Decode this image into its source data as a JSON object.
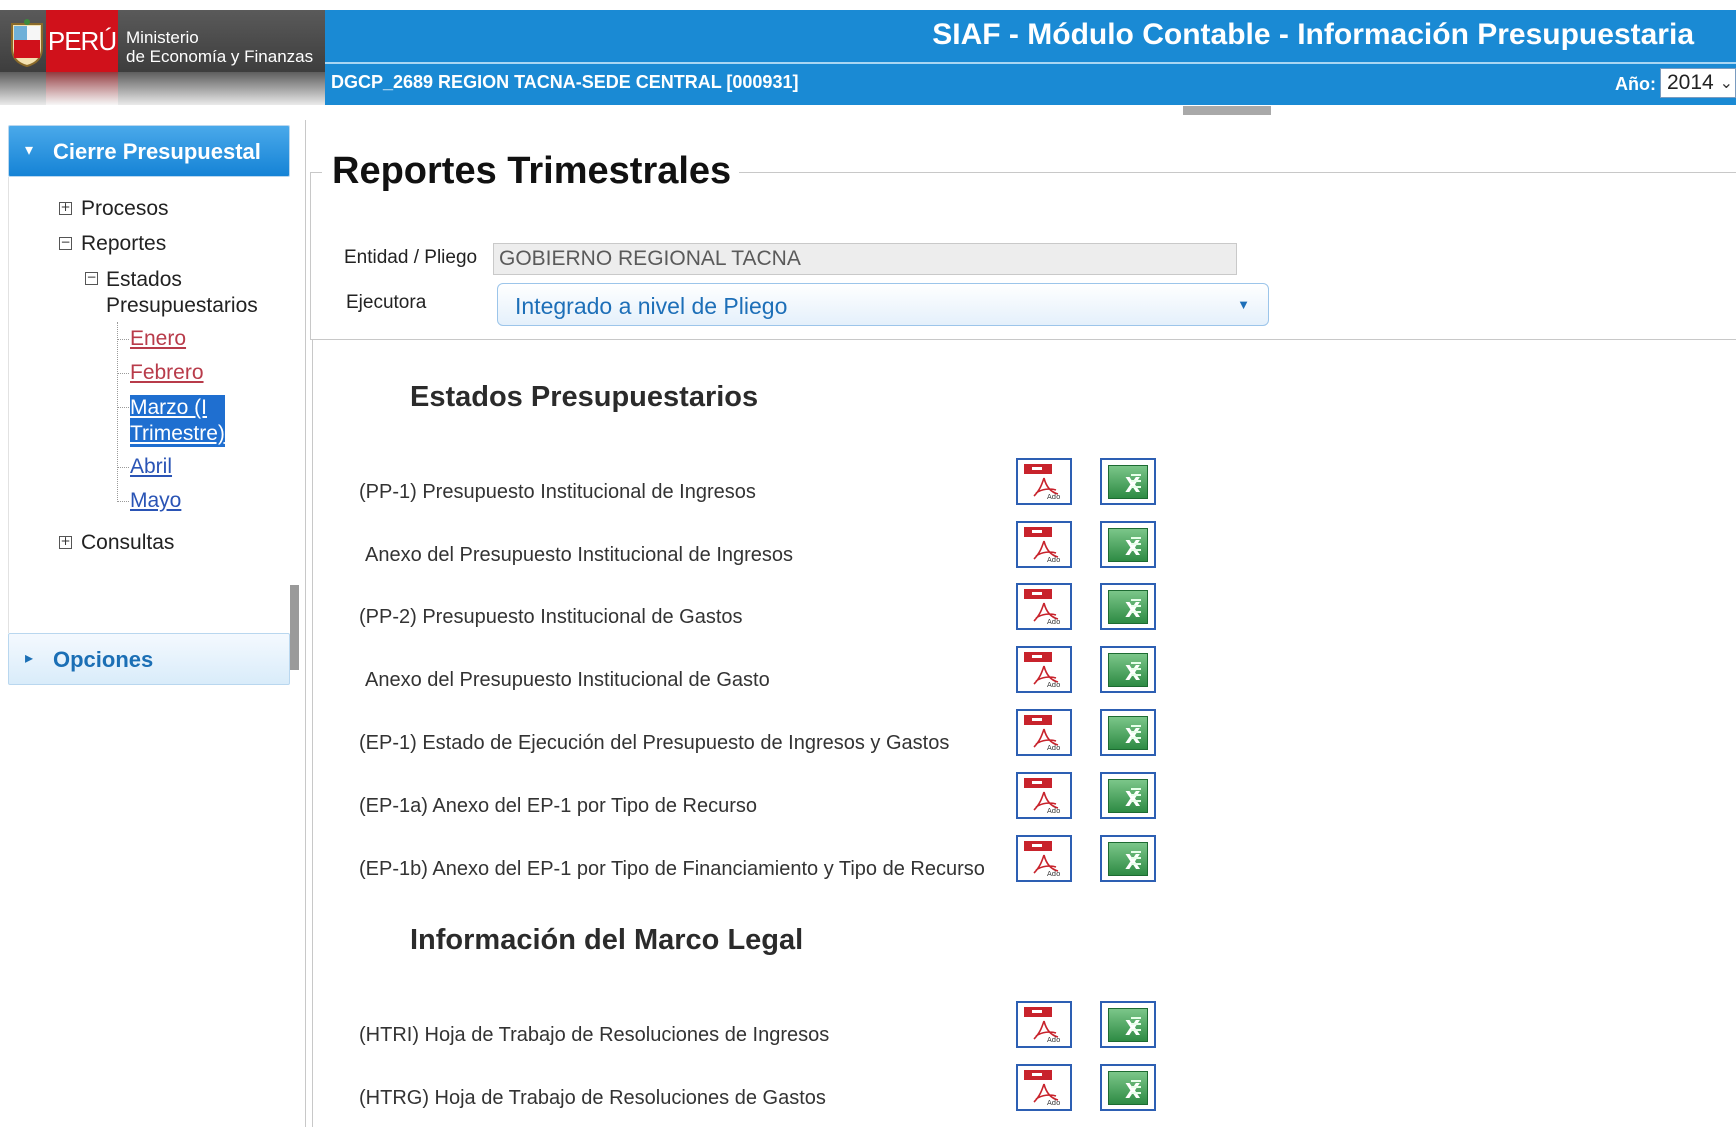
{
  "header": {
    "logo_country": "PERÚ",
    "logo_ministry_line1": "Ministerio",
    "logo_ministry_line2": "de Economía y Finanzas",
    "app_title": "SIAF - Módulo Contable - Información Presupuestaria",
    "entity": "DGCP_2689  REGION TACNA-SEDE CENTRAL  [000931]",
    "year_label": "Año:",
    "year_value": "2014"
  },
  "sidebar": {
    "active_section": "Cierre Presupuestal",
    "collapsed_section": "Opciones",
    "tree": {
      "procesos": "Procesos",
      "reportes": "Reportes",
      "estados_line1": "Estados",
      "estados_line2": "Presupuestarios",
      "months": [
        {
          "label_line1": "Enero",
          "label_line2": ""
        },
        {
          "label_line1": "Febrero",
          "label_line2": ""
        },
        {
          "label_line1": "Marzo (I",
          "label_line2": "Trimestre)"
        },
        {
          "label_line1": "Abril",
          "label_line2": ""
        },
        {
          "label_line1": "Mayo",
          "label_line2": ""
        }
      ],
      "consultas": "Consultas"
    }
  },
  "main": {
    "title": "Reportes Trimestrales",
    "entity_label": "Entidad / Pliego",
    "entity_value": "GOBIERNO REGIONAL TACNA",
    "executor_label": "Ejecutora",
    "executor_value": "Integrado a nivel de Pliego",
    "sections": [
      {
        "title": "Estados Presupuestarios",
        "reports": [
          "(PP-1) Presupuesto Institucional de Ingresos",
          "Anexo del Presupuesto Institucional de Ingresos",
          "(PP-2) Presupuesto Institucional de Gastos",
          "Anexo del Presupuesto Institucional de Gasto",
          "(EP-1) Estado de Ejecución del Presupuesto de Ingresos y Gastos",
          "(EP-1a) Anexo del EP-1 por Tipo de Recurso",
          "(EP-1b) Anexo del EP-1 por Tipo de Financiamiento y Tipo de Recurso"
        ]
      },
      {
        "title": "Información del Marco Legal",
        "reports": [
          "(HTRI) Hoja de Trabajo de Resoluciones de Ingresos",
          "(HTRG) Hoja de Trabajo de Resoluciones de Gastos"
        ]
      }
    ]
  },
  "colors": {
    "banner_blue": "#1a8ad4",
    "logo_red": "#d0111b",
    "link_red": "#b83b4a",
    "link_blue": "#2a54b5",
    "selected_bg": "#1f6fd0",
    "excel_green": "#2e8b44",
    "pdf_red": "#c8232c"
  },
  "icons": [
    "peru-shield-icon",
    "expand-icon",
    "collapse-icon",
    "pdf-icon",
    "excel-icon",
    "chevron-down-icon",
    "triangle-right-icon",
    "triangle-down-icon"
  ]
}
